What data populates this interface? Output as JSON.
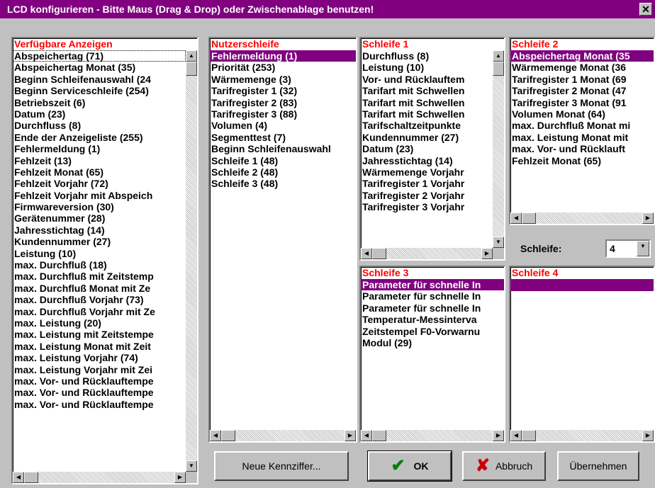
{
  "window": {
    "title": "LCD konfigurieren - Bitte Maus (Drag & Drop) oder Zwischenablage benutzen!",
    "close_glyph": "✕"
  },
  "panels": {
    "available": {
      "header": "Verfügbare Anzeigen",
      "items": [
        "Abspeichertag (71)",
        "Abspeichertag Monat (35)",
        "Beginn Schleifenauswahl (24",
        "Beginn Serviceschleife (254)",
        "Betriebszeit (6)",
        "Datum (23)",
        "Durchfluss (8)",
        "Ende der Anzeigeliste (255)",
        "Fehlermeldung (1)",
        "Fehlzeit (13)",
        "Fehlzeit Monat (65)",
        "Fehlzeit Vorjahr (72)",
        "Fehlzeit Vorjahr mit Abspeich",
        "Firmwareversion (30)",
        "Gerätenummer (28)",
        "Jahresstichtag (14)",
        "Kundennummer (27)",
        "Leistung (10)",
        "max. Durchfluß (18)",
        "max. Durchfluß mit Zeitstemp",
        "max. Durchfluß Monat mit Ze",
        "max. Durchfluß Vorjahr (73)",
        "max. Durchfluß Vorjahr mit Ze",
        "max. Leistung (20)",
        "max. Leistung mit Zeitstempe",
        "max. Leistung Monat mit Zeit",
        "max. Leistung Vorjahr (74)",
        "max. Leistung Vorjahr mit Zei",
        "max. Vor- und Rücklauftempe",
        "max. Vor- und Rücklauftempe",
        "max. Vor- und Rücklauftempe"
      ]
    },
    "nutzer": {
      "header": "Nutzerschleife",
      "items": [
        "Fehlermeldung (1)",
        "Priorität (253)",
        "Wärmemenge (3)",
        "Tarifregister 1 (32)",
        "Tarifregister 2 (83)",
        "Tarifregister 3 (88)",
        "Volumen (4)",
        "Segmenttest (7)",
        "Beginn Schleifenauswahl",
        "Schleife 1 (48)",
        "Schleife 2 (48)",
        "Schleife 3 (48)"
      ]
    },
    "schleife1": {
      "header": "Schleife 1",
      "items": [
        "Durchfluss (8)",
        "Leistung (10)",
        "Vor- und Rücklauftem",
        "Tarifart mit Schwellen",
        "Tarifart mit Schwellen",
        "Tarifart mit Schwellen",
        "Tarifschaltzeitpunkte",
        "Kundennummer (27)",
        "Datum (23)",
        "Jahresstichtag (14)",
        "Wärmemenge Vorjahr",
        "Tarifregister 1 Vorjahr",
        "Tarifregister 2 Vorjahr",
        "Tarifregister 3 Vorjahr"
      ]
    },
    "schleife2": {
      "header": "Schleife 2",
      "items": [
        "Abspeichertag Monat (35",
        "Wärmemenge Monat (36",
        "Tarifregister 1 Monat (69",
        "Tarifregister 2 Monat (47",
        "Tarifregister 3 Monat (91",
        "Volumen Monat (64)",
        "max. Durchfluß Monat mi",
        "max. Leistung Monat mit",
        "max. Vor- und Rücklauft",
        "Fehlzeit Monat (65)"
      ]
    },
    "schleife3": {
      "header": "Schleife 3",
      "items": [
        "Parameter für schnelle In",
        "Parameter für schnelle In",
        "Parameter für schnelle In",
        "Temperatur-Messinterva",
        "Zeitstempel F0-Vorwarnu",
        "Modul (29)"
      ]
    },
    "schleife4": {
      "header": "Schleife 4",
      "items": []
    }
  },
  "schleife_selector": {
    "label": "Schleife:",
    "value": "4"
  },
  "buttons": {
    "neue": "Neue Kennziffer...",
    "ok": "OK",
    "abbruch": "Abbruch",
    "uebernehmen": "Übernehmen",
    "ok_icon": "✔",
    "abbruch_icon": "✘"
  },
  "colors": {
    "title_bg": "#800080",
    "header_text": "#ff0000",
    "selection_bg": "#800080",
    "ok_icon": "#008000",
    "abbruch_icon": "#cc0000"
  }
}
